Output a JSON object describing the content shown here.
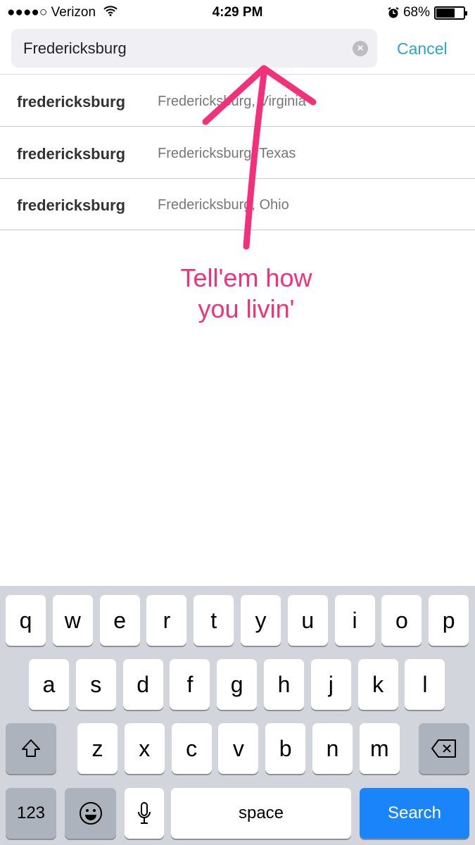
{
  "status_bar": {
    "signal": "●●●●○",
    "carrier": "Verizon",
    "time": "4:29 PM",
    "battery": "68%",
    "battery_level": 0.68,
    "icons": [
      "wifi-icon",
      "alarm-icon",
      "battery-icon"
    ]
  },
  "search": {
    "value": "Fredericksburg",
    "cancel_label": "Cancel",
    "clear_icon": "×"
  },
  "results": [
    {
      "name": "fredericksburg",
      "location": "Fredericksburg, Virginia"
    },
    {
      "name": "fredericksburg",
      "location": "Fredericksburg, Texas"
    },
    {
      "name": "fredericksburg",
      "location": "Fredericksburg, Ohio"
    }
  ],
  "annotation": {
    "line1": "Tell'em how",
    "line2": "you livin'",
    "color": "#f2317a"
  },
  "keyboard": {
    "row1": [
      "q",
      "w",
      "e",
      "r",
      "t",
      "y",
      "u",
      "i",
      "o",
      "p"
    ],
    "row2": [
      "a",
      "s",
      "d",
      "f",
      "g",
      "h",
      "j",
      "k",
      "l"
    ],
    "row3": [
      "z",
      "x",
      "c",
      "v",
      "b",
      "n",
      "m"
    ],
    "numbers_label": "123",
    "space_label": "space",
    "search_label": "Search",
    "accent": "#1a84fa"
  }
}
